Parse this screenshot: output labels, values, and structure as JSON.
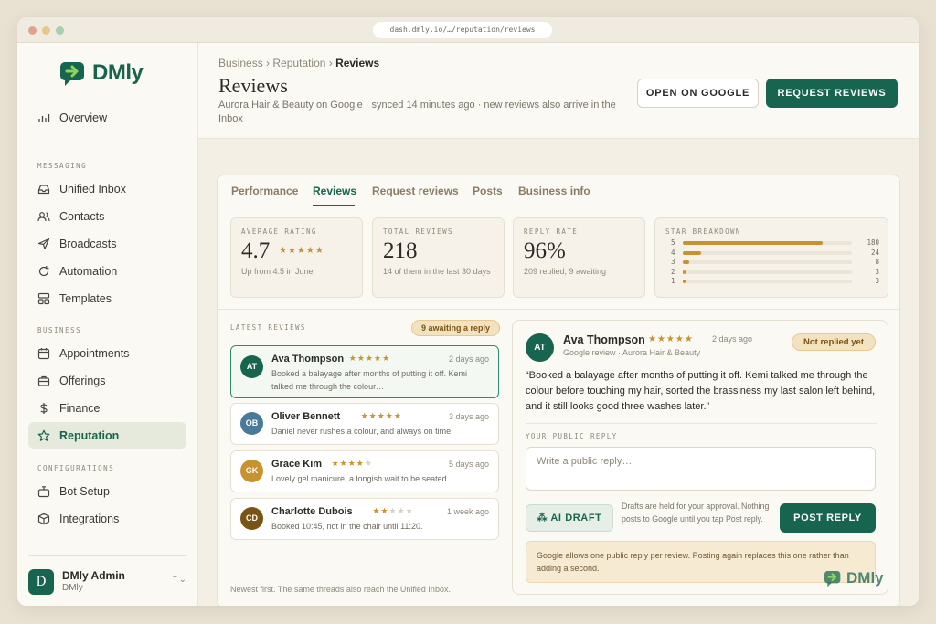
{
  "browser": {
    "url": "dash.dmly.io/…/reputation/reviews"
  },
  "brand": {
    "name": "DMly"
  },
  "sidebar": {
    "overview": "Overview",
    "sections": {
      "messaging": "MESSAGING",
      "business": "BUSINESS",
      "configurations": "CONFIGURATIONS"
    },
    "items": {
      "unified_inbox": "Unified Inbox",
      "contacts": "Contacts",
      "broadcasts": "Broadcasts",
      "automation": "Automation",
      "templates": "Templates",
      "appointments": "Appointments",
      "offerings": "Offerings",
      "finance": "Finance",
      "reputation": "Reputation",
      "bot_setup": "Bot Setup",
      "integrations": "Integrations"
    },
    "user": {
      "initial": "D",
      "name": "DMly Admin",
      "org": "DMly"
    }
  },
  "header": {
    "breadcrumb": {
      "business": "Business ›",
      "reputation": "Reputation ›",
      "current": "Reviews"
    },
    "title": "Reviews",
    "subtitle": "Aurora Hair & Beauty on Google · synced 14 minutes ago · new reviews also arrive in the Inbox",
    "open_google": "OPEN ON GOOGLE",
    "request_reviews": "REQUEST REVIEWS"
  },
  "tabs": [
    "Performance",
    "Reviews",
    "Request reviews",
    "Posts",
    "Business info"
  ],
  "stats": {
    "average": {
      "label": "AVERAGE RATING",
      "value": "4.7",
      "stars": "★★★★★",
      "note": "Up from 4.5 in June"
    },
    "total": {
      "label": "TOTAL REVIEWS",
      "value": "218",
      "note": "14 of them in the last 30 days"
    },
    "reply": {
      "label": "REPLY RATE",
      "value": "96%",
      "note": "209 replied, 9 awaiting"
    },
    "breakdown": {
      "label": "STAR BREAKDOWN",
      "rows": [
        {
          "star": "5",
          "count": "180",
          "fraction": 0.826
        },
        {
          "star": "4",
          "count": "24",
          "fraction": 0.11
        },
        {
          "star": "3",
          "count": "8",
          "fraction": 0.037
        },
        {
          "star": "2",
          "count": "3",
          "fraction": 0.014
        },
        {
          "star": "1",
          "count": "3",
          "fraction": 0.014
        }
      ]
    }
  },
  "reviews": {
    "label": "LATEST REVIEWS",
    "awaiting": "9 awaiting a reply",
    "footer": "Newest first. The same threads also reach the Unified Inbox.",
    "items": [
      {
        "initials": "AT",
        "name": "Ava Thompson",
        "stars_on": "★★★★★",
        "stars_off": "",
        "rating": 5,
        "date": "2 days ago",
        "text": "Booked a balayage after months of putting it off. Kemi talked me through the colour…",
        "color": "#17654f"
      },
      {
        "initials": "OB",
        "name": "Oliver Bennett",
        "stars_on": "★★★★★",
        "stars_off": "",
        "rating": 5,
        "date": "3 days ago",
        "text": "Daniel never rushes a colour, and always on time.",
        "color": "#4a7a9a"
      },
      {
        "initials": "GK",
        "name": "Grace Kim",
        "stars_on": "★★★★",
        "stars_off": "★",
        "rating": 4,
        "date": "5 days ago",
        "text": "Lovely gel manicure, a longish wait to be seated.",
        "color": "#c8922e"
      },
      {
        "initials": "CD",
        "name": "Charlotte Dubois",
        "stars_on": "★★",
        "stars_off": "★★★",
        "rating": 2,
        "date": "1 week ago",
        "text": "Booked 10:45, not in the chair until 11:20.",
        "color": "#7a5414"
      }
    ]
  },
  "detail": {
    "initials": "AT",
    "name": "Ava Thompson",
    "stars": "★★★★★",
    "date": "2 days ago",
    "source": "Google review · Aurora Hair & Beauty",
    "status": "Not replied yet",
    "quote": "“Booked a balayage after months of putting it off. Kemi talked me through the colour before touching my hair, sorted the brassiness my last salon left behind, and it still looks good three washes later.”",
    "reply_label": "YOUR PUBLIC REPLY",
    "reply_placeholder": "Write a public reply…",
    "ai_draft": "AI DRAFT",
    "draft_note": "Drafts are held for your approval. Nothing posts to Google until you tap Post reply.",
    "post_reply": "POST REPLY",
    "notice": "Google allows one public reply per review. Posting again replaces this one rather than adding a second."
  },
  "colors": {
    "accent": "#17654f",
    "star": "#c8922e",
    "pill_bg": "#f3e2c0"
  }
}
